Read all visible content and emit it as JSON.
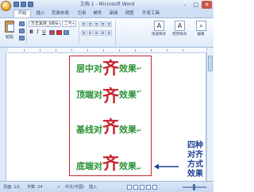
{
  "window": {
    "title": "文档 1 - Microsoft Word"
  },
  "tabs": [
    "开始",
    "插入",
    "页面布局",
    "引用",
    "邮件",
    "审阅",
    "视图",
    "开发工具"
  ],
  "ribbon": {
    "paste_label": "粘贴",
    "font_name": "方正黑体_GBK",
    "font_size": "二号",
    "bold": "B",
    "italic": "I",
    "underline": "U",
    "quick_styles_label": "快速样式",
    "change_styles_label": "更改样式",
    "editing_label": "编辑"
  },
  "document": {
    "lines": [
      {
        "lead": "居中对",
        "char": "齐",
        "tail": "效果"
      },
      {
        "lead": "顶端对",
        "char": "齐",
        "tail": "效果"
      },
      {
        "lead": "基线对",
        "char": "齐",
        "tail": "效果"
      },
      {
        "lead": "底端对",
        "char": "齐",
        "tail": "效果"
      }
    ],
    "annotation": "四种对齐方式效果"
  },
  "statusbar": {
    "page": "页面: 1/1",
    "words": "字数: 24",
    "language": "中文(中国)",
    "mode": "插入"
  },
  "colors": {
    "green_text": "#279033",
    "red_char": "#c8242d",
    "border": "#c3232b",
    "annotation": "#1d3f94"
  }
}
